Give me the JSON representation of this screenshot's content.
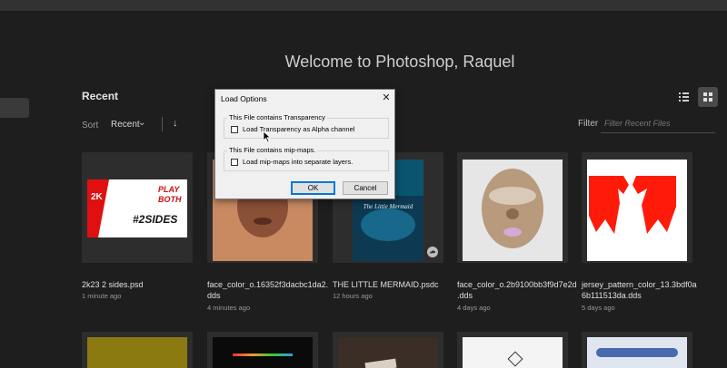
{
  "header": {
    "welcome": "Welcome to Photoshop, Raquel"
  },
  "recent": {
    "title": "Recent",
    "sort_label": "Sort",
    "sort_value": "Recent",
    "filter_label": "Filter",
    "filter_placeholder": "Filter Recent Files"
  },
  "files": [
    {
      "name": "2k23 2 sides.psd",
      "time": "1 minute ago",
      "thumb_text_a": "PLAY",
      "thumb_text_b": "BOTH",
      "thumb_text_c": "#2SIDES",
      "thumb_text_d": "2K"
    },
    {
      "name": "face_color_o.16352f3dacbc1da2.\ndds",
      "time": "4 minutes ago"
    },
    {
      "name": "THE LITTLE MERMAID.psdc",
      "time": "12 hours ago",
      "poster_title": "The Little Mermaid"
    },
    {
      "name": "face_color_o.2b9100bb3f9d7e2d\n.dds",
      "time": "4 days ago"
    },
    {
      "name": "jersey_pattern_color_13.3bdf0a\n6b111513da.dds",
      "time": "5 days ago"
    }
  ],
  "dialog": {
    "title": "Load Options",
    "group1_legend": "This File contains Transparency",
    "group1_option": "Load Transparency as Alpha channel",
    "group2_legend": "This File contains mip-maps.",
    "group2_option": "Load mip-maps into separate layers.",
    "ok_label": "OK",
    "cancel_label": "Cancel"
  },
  "colors": {
    "background": "#1e1e1e",
    "card": "#2d2d2d",
    "accent_red": "#ff1a0a",
    "dialog_bg": "#f0f0f0",
    "ok_border": "#0078d7"
  },
  "icons": {
    "sort_chevron": "chevron-down-icon",
    "sort_direction": "arrow-down-icon",
    "list_view": "list-view-icon",
    "grid_view": "grid-view-icon",
    "cloud": "cloud-icon",
    "close": "close-icon"
  }
}
